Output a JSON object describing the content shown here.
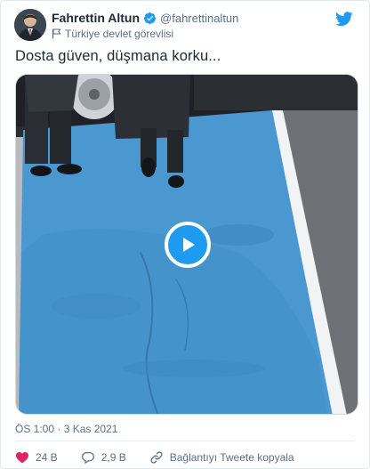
{
  "author": {
    "display_name": "Fahrettin Altun",
    "handle": "@fahrettinaltun",
    "account_label": "Türkiye devlet görevlisi",
    "avatar_icon": "avatar-photo",
    "verified_icon": "verified-badge-icon"
  },
  "brand": {
    "icon": "twitter-bird-icon",
    "color": "#1d9bf0"
  },
  "tweet": {
    "text": "Dosta güven, düşmana korku...",
    "timestamp": "ÖS 1:00 · 3 Kas 2021"
  },
  "media": {
    "type": "video",
    "play_icon": "play-icon"
  },
  "actions": {
    "like_count": "24 B",
    "reply_count": "2,9 B",
    "copy_link_label": "Bağlantıyı Tweete kopyala",
    "like_color": "#e0245e"
  }
}
